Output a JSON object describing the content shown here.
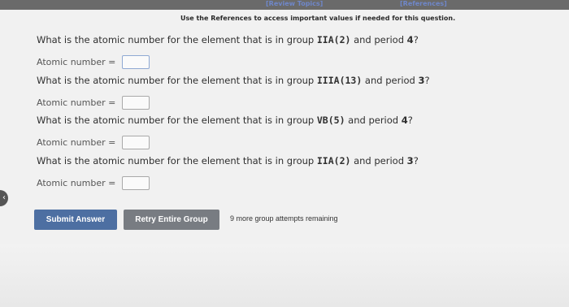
{
  "header": {
    "review_topics": "[Review Topics]",
    "references": "[References]",
    "instructions": "Use the References to access important values if needed for this question."
  },
  "questions": [
    {
      "prefix": "What is the atomic number for the element that is in group ",
      "group": "IIA(2)",
      "mid": " and period ",
      "period": "4",
      "suffix": "?"
    },
    {
      "prefix": "What is the atomic number for the element that is in group ",
      "group": "IIIA(13)",
      "mid": " and period ",
      "period": "3",
      "suffix": "?"
    },
    {
      "prefix": "What is the atomic number for the element that is in group ",
      "group": "VB(5)",
      "mid": " and period ",
      "period": "4",
      "suffix": "?"
    },
    {
      "prefix": "What is the atomic number for the element that is in group ",
      "group": "IIA(2)",
      "mid": " and period ",
      "period": "3",
      "suffix": "?"
    }
  ],
  "answer_label": "Atomic number =",
  "answers": [
    "",
    "",
    "",
    ""
  ],
  "buttons": {
    "submit": "Submit Answer",
    "retry": "Retry Entire Group"
  },
  "attempts_text": "9 more group attempts remaining",
  "icons": {
    "side_handle": "chevron-left-icon"
  }
}
